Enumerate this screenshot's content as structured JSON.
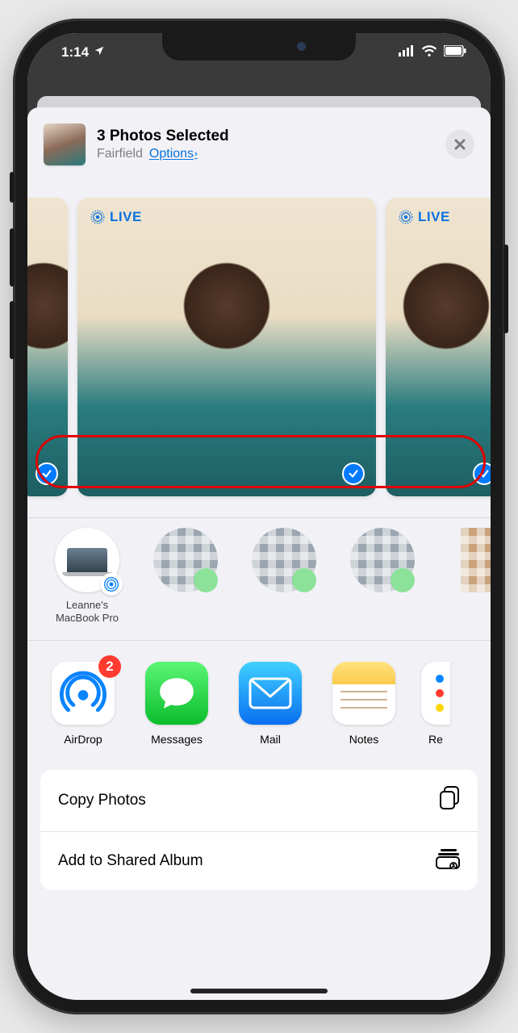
{
  "status_bar": {
    "time": "1:14"
  },
  "sheet": {
    "title": "3 Photos Selected",
    "location": "Fairfield",
    "options_label": "Options"
  },
  "photos": {
    "live_label": "LIVE"
  },
  "airdrop_contact": {
    "label": "Leanne's MacBook Pro"
  },
  "apps": {
    "airdrop": {
      "label": "AirDrop",
      "badge": "2"
    },
    "messages": {
      "label": "Messages"
    },
    "mail": {
      "label": "Mail"
    },
    "notes": {
      "label": "Notes"
    },
    "partial": {
      "label": "Re"
    }
  },
  "actions": {
    "copy": "Copy Photos",
    "shared_album": "Add to Shared Album"
  }
}
